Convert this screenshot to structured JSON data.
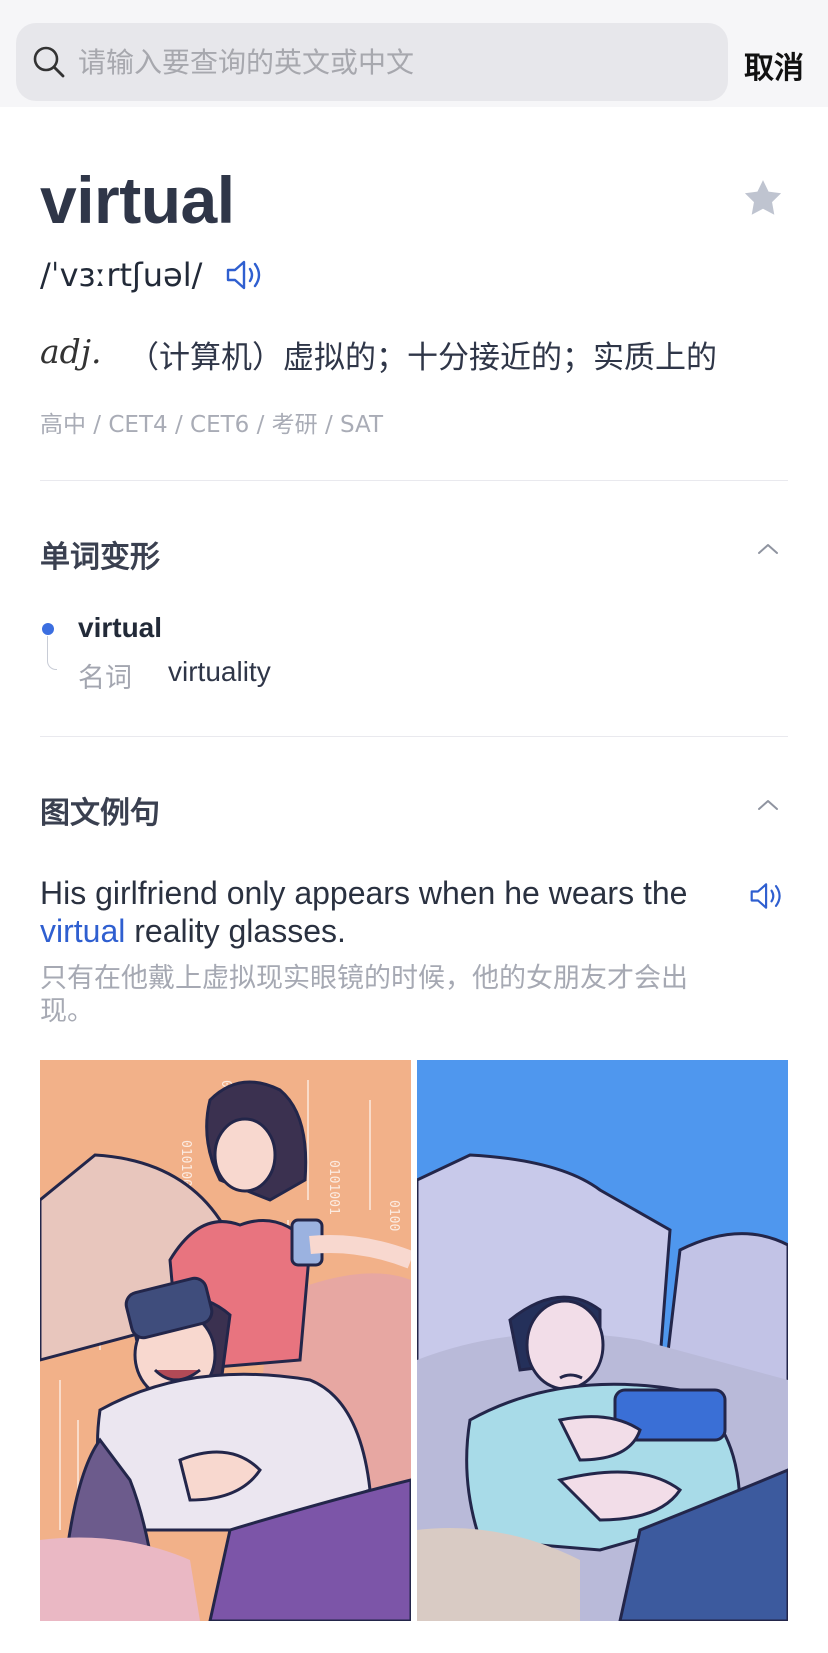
{
  "search": {
    "placeholder": "请输入要查询的英文或中文",
    "cancel_label": "取消"
  },
  "entry": {
    "word": "virtual",
    "phonetic": "/ˈvɜːrtʃuəl/",
    "pos": "adj.",
    "definition": "（计算机）虚拟的；十分接近的；实质上的",
    "tags": "高中 / CET4 / CET6 / 考研 / SAT"
  },
  "forms_section": {
    "title": "单词变形",
    "base": "virtual",
    "items": [
      {
        "type": "名词",
        "value": "virtuality"
      }
    ]
  },
  "examples_section": {
    "title": "图文例句",
    "sentence_before": "His girlfriend only appears when he wears the ",
    "sentence_highlight": "virtual",
    "sentence_after": " reality glasses.",
    "translation": "只有在他戴上虚拟现实眼镜的时候，他的女朋友才会出现。"
  },
  "colors": {
    "accent": "#2f5fd0",
    "star": "#bfc4d0",
    "panel_left_bg": "#f2b189",
    "panel_right_bg": "#4f97ee"
  },
  "icons": [
    "search-icon",
    "star-icon",
    "speaker-icon",
    "chevron-up-icon"
  ]
}
